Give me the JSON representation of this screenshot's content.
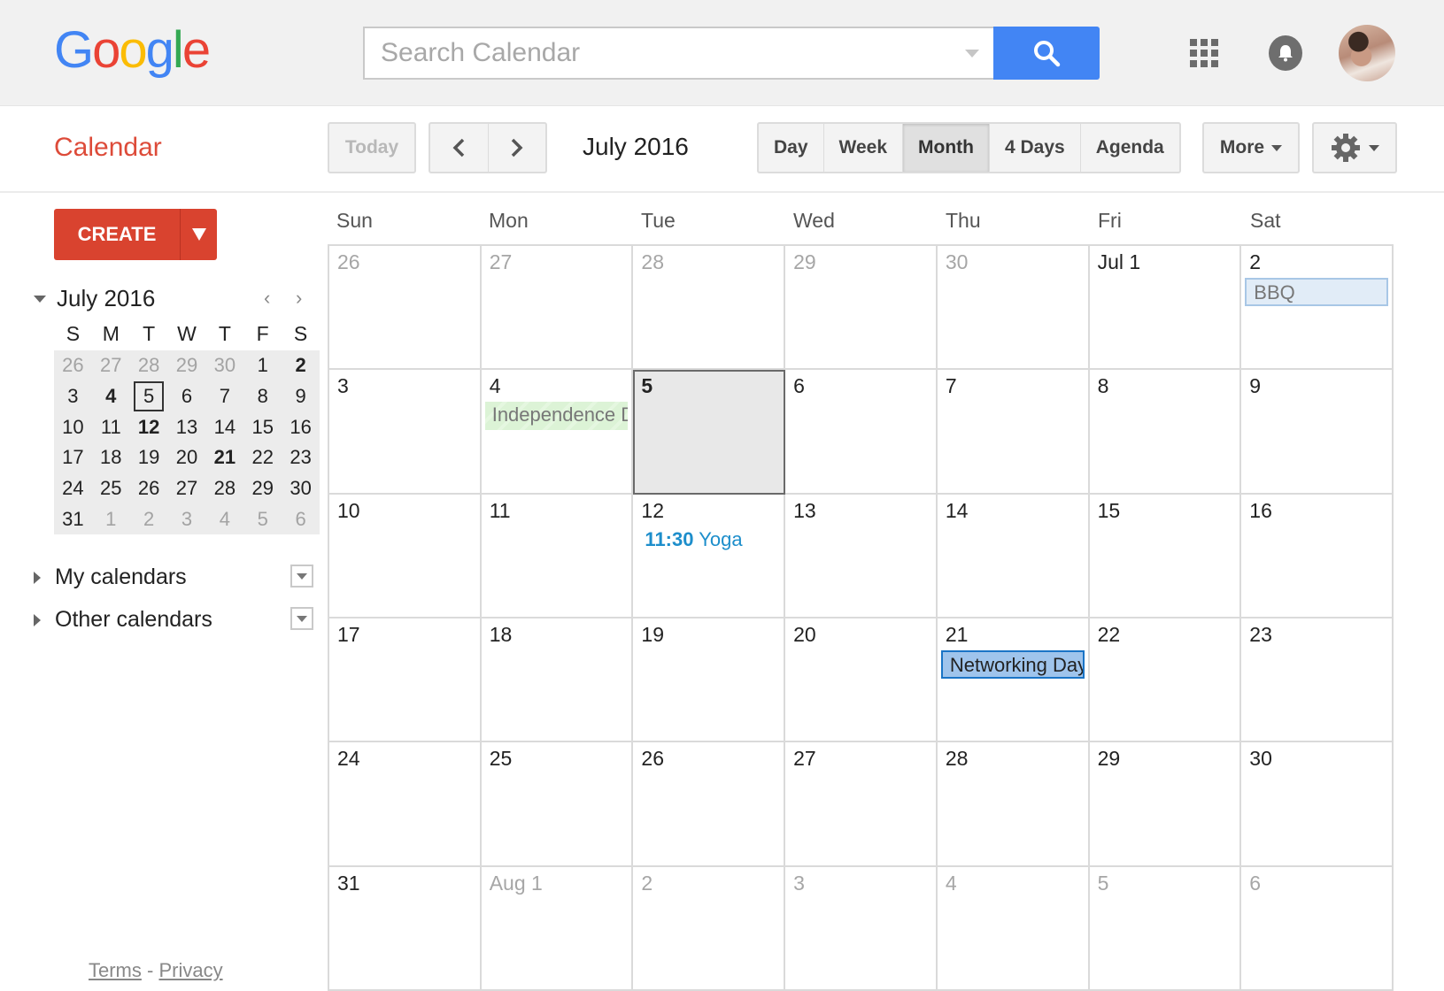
{
  "header": {
    "logo_letters": [
      {
        "ch": "G",
        "color": "#4285f4"
      },
      {
        "ch": "o",
        "color": "#ea4335"
      },
      {
        "ch": "o",
        "color": "#fbbc05"
      },
      {
        "ch": "g",
        "color": "#4285f4"
      },
      {
        "ch": "l",
        "color": "#34a853"
      },
      {
        "ch": "e",
        "color": "#ea4335"
      }
    ],
    "search_placeholder": "Search Calendar",
    "search_value": "",
    "icons": [
      "search-icon",
      "apps-grid-icon",
      "notifications-bell-icon",
      "account-avatar"
    ]
  },
  "toolbar": {
    "app_title": "Calendar",
    "today_label": "Today",
    "prev_icon": "‹",
    "next_icon": "›",
    "current_range": "July 2016",
    "views": [
      {
        "label": "Day",
        "active": false
      },
      {
        "label": "Week",
        "active": false
      },
      {
        "label": "Month",
        "active": true
      },
      {
        "label": "4 Days",
        "active": false
      },
      {
        "label": "Agenda",
        "active": false
      }
    ],
    "more_label": "More",
    "settings_icon": "gear-icon"
  },
  "sidebar": {
    "create_label": "CREATE",
    "mini_calendar": {
      "title": "July 2016",
      "prev": "‹",
      "next": "›",
      "weekdays": [
        "S",
        "M",
        "T",
        "W",
        "T",
        "F",
        "S"
      ],
      "days": [
        {
          "d": "26",
          "other": true
        },
        {
          "d": "27",
          "other": true
        },
        {
          "d": "28",
          "other": true
        },
        {
          "d": "29",
          "other": true
        },
        {
          "d": "30",
          "other": true
        },
        {
          "d": "1"
        },
        {
          "d": "2",
          "bold": true
        },
        {
          "d": "3"
        },
        {
          "d": "4",
          "bold": true
        },
        {
          "d": "5",
          "today": true
        },
        {
          "d": "6"
        },
        {
          "d": "7"
        },
        {
          "d": "8"
        },
        {
          "d": "9"
        },
        {
          "d": "10"
        },
        {
          "d": "11"
        },
        {
          "d": "12",
          "bold": true
        },
        {
          "d": "13"
        },
        {
          "d": "14"
        },
        {
          "d": "15"
        },
        {
          "d": "16"
        },
        {
          "d": "17"
        },
        {
          "d": "18"
        },
        {
          "d": "19"
        },
        {
          "d": "20"
        },
        {
          "d": "21",
          "bold": true
        },
        {
          "d": "22"
        },
        {
          "d": "23"
        },
        {
          "d": "24"
        },
        {
          "d": "25"
        },
        {
          "d": "26"
        },
        {
          "d": "27"
        },
        {
          "d": "28"
        },
        {
          "d": "29"
        },
        {
          "d": "30"
        },
        {
          "d": "31"
        },
        {
          "d": "1",
          "other": true
        },
        {
          "d": "2",
          "other": true
        },
        {
          "d": "3",
          "other": true
        },
        {
          "d": "4",
          "other": true
        },
        {
          "d": "5",
          "other": true
        },
        {
          "d": "6",
          "other": true
        }
      ]
    },
    "sections": [
      {
        "label": "My calendars"
      },
      {
        "label": "Other calendars"
      }
    ],
    "footer": {
      "terms": "Terms",
      "separator": " - ",
      "privacy": "Privacy"
    }
  },
  "month": {
    "weekdays": [
      "Sun",
      "Mon",
      "Tue",
      "Wed",
      "Thu",
      "Fri",
      "Sat"
    ],
    "days": [
      {
        "label": "26",
        "other": true
      },
      {
        "label": "27",
        "other": true
      },
      {
        "label": "28",
        "other": true
      },
      {
        "label": "29",
        "other": true
      },
      {
        "label": "30",
        "other": true
      },
      {
        "label": "Jul 1"
      },
      {
        "label": "2",
        "event": {
          "title": "BBQ",
          "style": "ev-allday-light"
        }
      },
      {
        "label": "3"
      },
      {
        "label": "4",
        "event": {
          "title": "Independence Day",
          "style": "ev-holiday"
        }
      },
      {
        "label": "5",
        "today": true
      },
      {
        "label": "6"
      },
      {
        "label": "7"
      },
      {
        "label": "8"
      },
      {
        "label": "9"
      },
      {
        "label": "10"
      },
      {
        "label": "11"
      },
      {
        "label": "12",
        "event": {
          "time": "11:30",
          "title": "Yoga",
          "style": "ev-timed"
        }
      },
      {
        "label": "13"
      },
      {
        "label": "14"
      },
      {
        "label": "15"
      },
      {
        "label": "16"
      },
      {
        "label": "17"
      },
      {
        "label": "18"
      },
      {
        "label": "19"
      },
      {
        "label": "20"
      },
      {
        "label": "21",
        "event": {
          "title": "Networking Day",
          "style": "ev-selected"
        }
      },
      {
        "label": "22"
      },
      {
        "label": "23"
      },
      {
        "label": "24"
      },
      {
        "label": "25"
      },
      {
        "label": "26"
      },
      {
        "label": "27"
      },
      {
        "label": "28"
      },
      {
        "label": "29"
      },
      {
        "label": "30"
      },
      {
        "label": "31"
      },
      {
        "label": "Aug 1",
        "other": true
      },
      {
        "label": "2",
        "other": true
      },
      {
        "label": "3",
        "other": true
      },
      {
        "label": "4",
        "other": true
      },
      {
        "label": "5",
        "other": true
      },
      {
        "label": "6",
        "other": true
      }
    ]
  }
}
